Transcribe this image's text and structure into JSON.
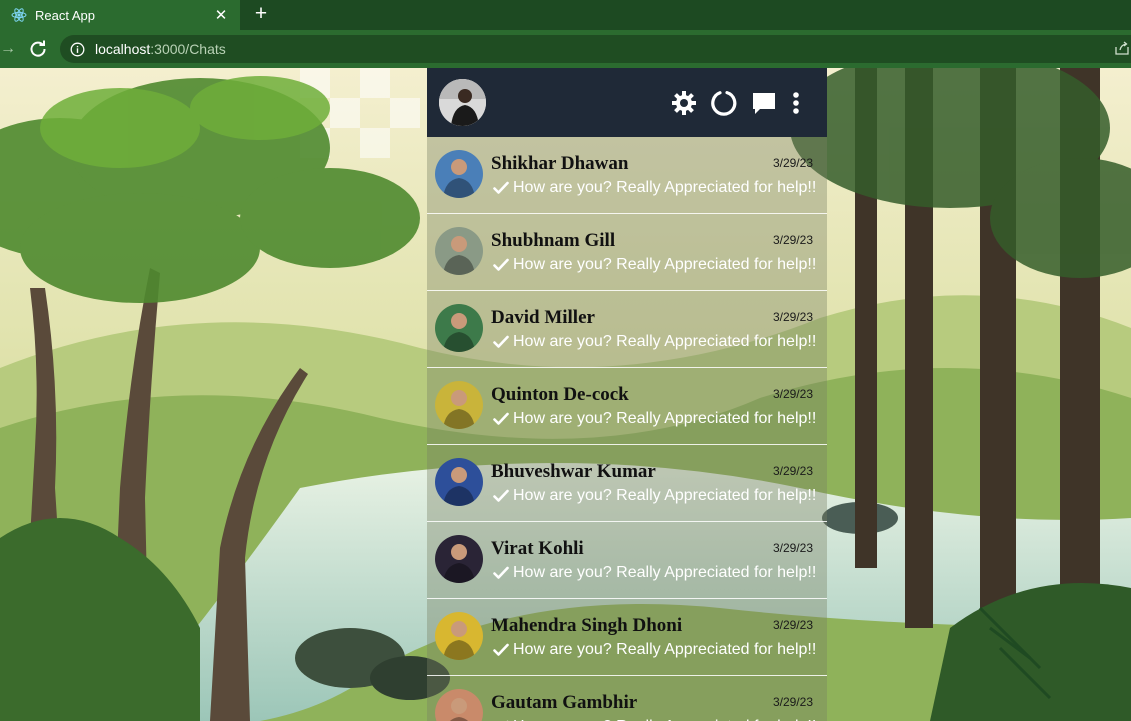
{
  "browser": {
    "tab_title": "React App",
    "url_host": "localhost",
    "url_path": ":3000/Chats"
  },
  "header": {
    "icons": [
      "settings-icon",
      "status-icon",
      "new-chat-icon",
      "menu-icon"
    ]
  },
  "chats": [
    {
      "name": "Shikhar Dhawan",
      "time": "3/29/23",
      "message": "How are you? Really Appreciated for help!!",
      "avatar_color": "#4a7fb8"
    },
    {
      "name": "Shubhnam Gill",
      "time": "3/29/23",
      "message": "How are you? Really Appreciated for help!!",
      "avatar_color": "#8a9a86"
    },
    {
      "name": "David Miller",
      "time": "3/29/23",
      "message": "How are you? Really Appreciated for help!!",
      "avatar_color": "#3d7a4a"
    },
    {
      "name": "Quinton De-cock",
      "time": "3/29/23",
      "message": "How are you? Really Appreciated for help!!",
      "avatar_color": "#c9b43a"
    },
    {
      "name": "Bhuveshwar Kumar",
      "time": "3/29/23",
      "message": "How are you? Really Appreciated for help!!",
      "avatar_color": "#2d4f9a"
    },
    {
      "name": "Virat Kohli",
      "time": "3/29/23",
      "message": "How are you? Really Appreciated for help!!",
      "avatar_color": "#2a2436"
    },
    {
      "name": "Mahendra Singh Dhoni",
      "time": "3/29/23",
      "message": "How are you? Really Appreciated for help!!",
      "avatar_color": "#d8b730"
    },
    {
      "name": "Gautam Gambhir",
      "time": "3/29/23",
      "message": "How are you? Really Appreciated for help!!",
      "avatar_color": "#c98a6a"
    }
  ]
}
